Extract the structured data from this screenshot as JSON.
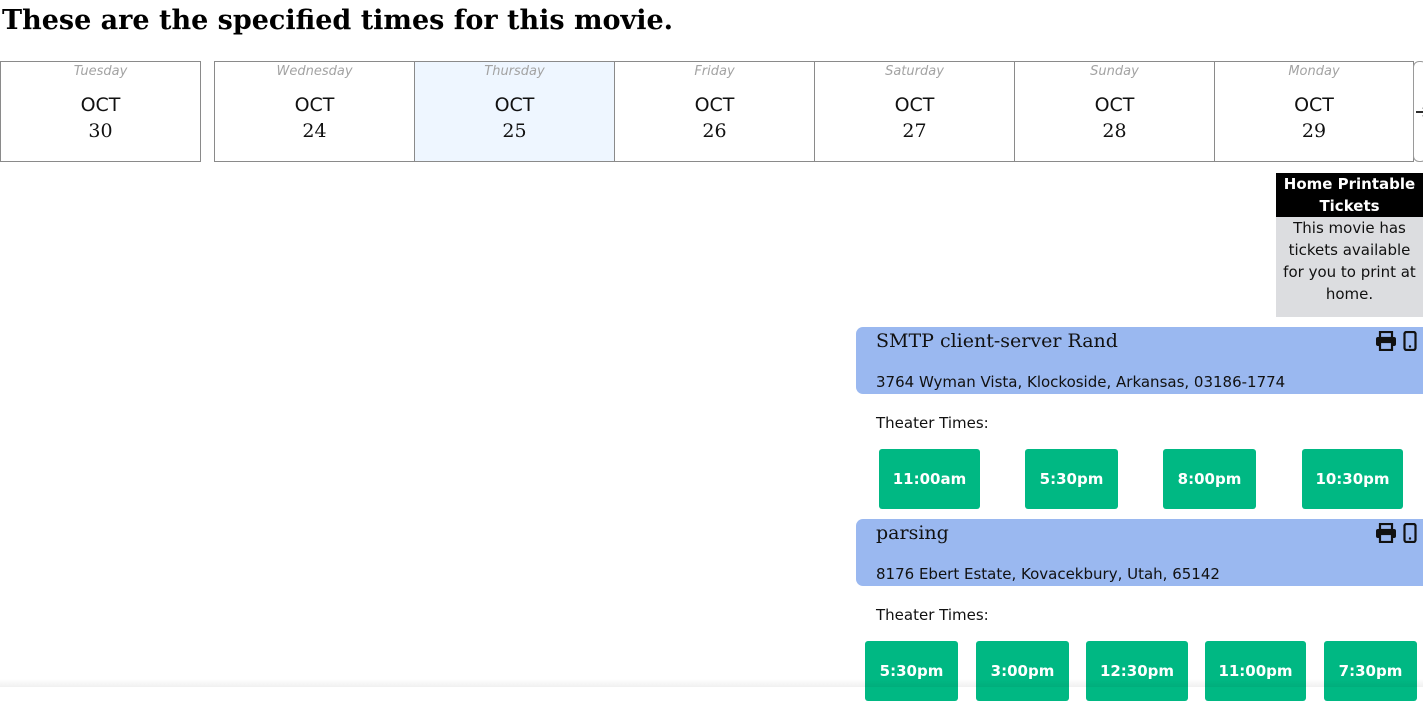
{
  "page": {
    "title": "These are the specified times for this movie."
  },
  "date_nav": {
    "prev_icon": "arrow-left-icon",
    "next_icon": "arrow-right-icon",
    "days": [
      {
        "weekday": "Wednesday",
        "month": "OCT",
        "day": "24",
        "selected": false
      },
      {
        "weekday": "Thursday",
        "month": "OCT",
        "day": "25",
        "selected": true
      },
      {
        "weekday": "Friday",
        "month": "OCT",
        "day": "26",
        "selected": false
      },
      {
        "weekday": "Saturday",
        "month": "OCT",
        "day": "27",
        "selected": false
      },
      {
        "weekday": "Sunday",
        "month": "OCT",
        "day": "28",
        "selected": false
      },
      {
        "weekday": "Monday",
        "month": "OCT",
        "day": "29",
        "selected": false
      },
      {
        "weekday": "Tuesday",
        "month": "OCT",
        "day": "30",
        "selected": false
      }
    ]
  },
  "home_printable": {
    "title": "Home Printable Tickets",
    "text": "This movie has tickets available for you to print at home."
  },
  "theaters": [
    {
      "name": "SMTP client-server Rand",
      "address": "3764 Wyman Vista, Klockoside, Arkansas, 03186-1774",
      "times_label": "Theater Times:",
      "icons": [
        "printer-icon",
        "mobile-phone-icon"
      ],
      "times": [
        "11:00am",
        "5:30pm",
        "8:00pm",
        "10:30pm"
      ]
    },
    {
      "name": "parsing",
      "address": "8176 Ebert Estate, Kovacekbury, Utah, 65142",
      "times_label": "Theater Times:",
      "icons": [
        "printer-icon",
        "mobile-phone-icon"
      ],
      "times": [
        "5:30pm",
        "3:00pm",
        "12:30pm",
        "11:00pm",
        "7:30pm"
      ]
    }
  ],
  "colors": {
    "theater_header": "#9ab8f0",
    "time_button": "#00b883",
    "selected_day": "#eef6ff",
    "printable_title_bg": "#000000",
    "printable_body_bg": "#dcdde0"
  }
}
